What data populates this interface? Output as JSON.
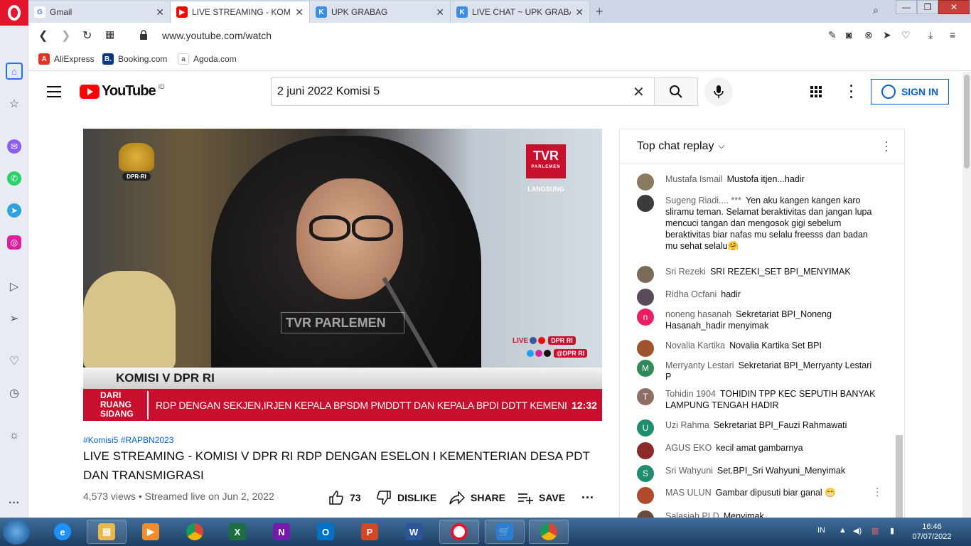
{
  "browser": {
    "tabs": [
      {
        "label": "Gmail",
        "icon_char": "G",
        "color": "#4285f4"
      },
      {
        "label": "LIVE STREAMING - KOMISI",
        "icon_char": "▶",
        "color": "#ff0000"
      },
      {
        "label": "UPK GRABAG",
        "icon_char": "K",
        "color": "#3a8ee6"
      },
      {
        "label": "LIVE CHAT ~ UPK GRABAG",
        "icon_char": "K",
        "color": "#3a8ee6"
      }
    ],
    "url": "www.youtube.com/watch",
    "bookmarks": [
      {
        "label": "AliExpress",
        "icon_char": "A",
        "color": "#e43225"
      },
      {
        "label": "Booking.com",
        "icon_char": "B.",
        "color": "#003580"
      },
      {
        "label": "Agoda.com",
        "icon_char": "a",
        "color": "#888888"
      }
    ]
  },
  "youtube": {
    "logo_text": "YouTube",
    "country_code": "ID",
    "search_value": "2 juni 2022 Komisi 5",
    "signin_label": "SIGN IN"
  },
  "video": {
    "overlay": {
      "emblem_label": "DPR-RI",
      "channel_logo": "TVR",
      "channel_sub": "PARLEMEN",
      "live_badge": "LANGSUNG",
      "watermark": "TVR PARLEMEN",
      "live_label": "LIVE",
      "social_1": "DPR RI",
      "social_2": "@DPR RI",
      "komisi_bar": "KOMISI V DPR RI",
      "dari_label": "DARI RUANG SIDANG",
      "ticker": "RDP DENGAN SEKJEN,IRJEN KEPALA BPSDM PMDDTT DAN KEPALA BPDI DDTT KEMENDES PDTT",
      "clock": "12:32"
    },
    "hashtags": "#Komisi5 #RAPBN2023",
    "title": "LIVE STREAMING - KOMISI V DPR RI RDP DENGAN ESELON I KEMENTERIAN DESA PDT DAN TRANSMIGRASI",
    "views": "4,573 views • Streamed live on Jun 2, 2022",
    "likes": "73",
    "dislike_label": "DISLIKE",
    "share_label": "SHARE",
    "save_label": "SAVE"
  },
  "chat": {
    "header": "Top chat replay",
    "messages": [
      {
        "author": "Mustafa Ismail",
        "text": "Mustofa itjen...hadir",
        "avatar": "",
        "color": "#8a7a60"
      },
      {
        "author": "Sugeng Riadi.... ***",
        "text": "Yen aku kangen kangen karo sliramu teman. Selamat beraktivitas dan jangan lupa mencuci tangan dan mengosok gigi sebelum beraktivitas biar nafas mu selalu freesss dan badan mu sehat selalu🤗",
        "avatar": "",
        "color": "#3b3b3b"
      },
      {
        "author": "Sri Rezeki",
        "text": "SRI REZEKI_SET BPI_MENYIMAK",
        "avatar": "",
        "color": "#7a6a5a"
      },
      {
        "author": "Ridha Ocfani",
        "text": "hadir",
        "avatar": "",
        "color": "#5a4a5a"
      },
      {
        "author": "noneng hasanah",
        "text": "Sekretariat BPI_Noneng Hasanah_hadir menyimak",
        "avatar": "n",
        "color": "#e91e63"
      },
      {
        "author": "Novalia Kartika",
        "text": "Novalia Kartika Set BPI",
        "avatar": "",
        "color": "#a0522d"
      },
      {
        "author": "Merryanty Lestari",
        "text": "Sekretariat BPI_Merryanty Lestari P",
        "avatar": "M",
        "color": "#2e8b57"
      },
      {
        "author": "Tohidin 1904",
        "text": "TOHIDIN TPP KEC SEPUTIH BANYAK LAMPUNG TENGAH HADIR",
        "avatar": "T",
        "color": "#8d6e63"
      },
      {
        "author": "Uzi Rahma",
        "text": "Sekretariat BPI_Fauzi Rahmawati",
        "avatar": "U",
        "color": "#1e8e6e"
      },
      {
        "author": "AGUS EKO",
        "text": "kecil amat gambarnya",
        "avatar": "",
        "color": "#8b2a2a"
      },
      {
        "author": "Sri Wahyuni",
        "text": "Set.BPI_Sri Wahyuni_Menyimak",
        "avatar": "S",
        "color": "#1e8e6e"
      },
      {
        "author": "MAS ULUN",
        "text": "Gambar dipusuti biar ganal 😁",
        "avatar": "",
        "color": "#b04a2a"
      },
      {
        "author": "Salasiah PLD",
        "text": "Menyimak",
        "avatar": "",
        "color": "#6a4a3a"
      }
    ]
  },
  "taskbar": {
    "lang": "IN",
    "time": "16:46",
    "date": "07/07/2022"
  }
}
